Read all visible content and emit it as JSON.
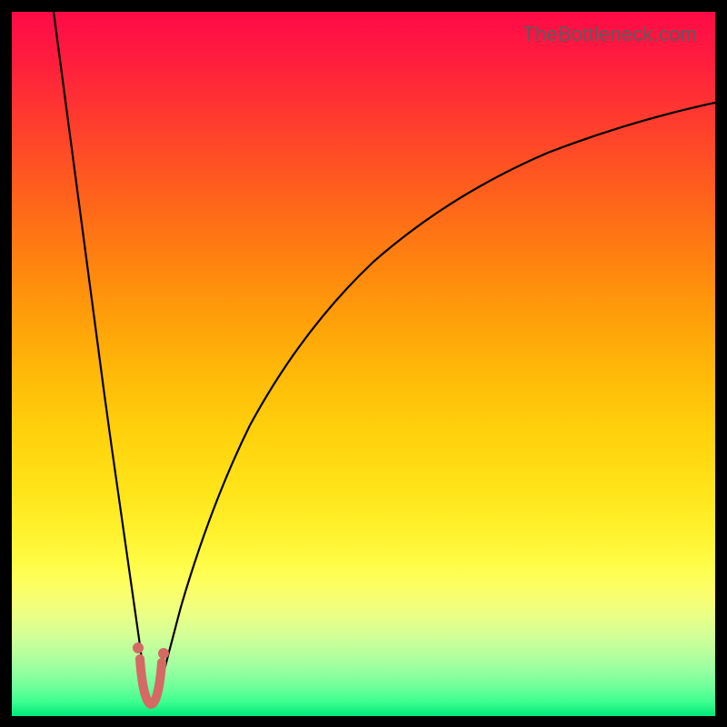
{
  "watermark": "TheBottleneck.com",
  "colors": {
    "frame": "#000000",
    "curve": "#000000",
    "marker": "#d46a63",
    "gradient_top": "#ff0b47",
    "gradient_bottom": "#00e77a"
  },
  "chart_data": {
    "type": "line",
    "title": "",
    "xlabel": "",
    "ylabel": "",
    "xlim": [
      0,
      100
    ],
    "ylim": [
      0,
      100
    ],
    "note": "Bottleneck-style curve: y is percent mismatch vs x (component ratio). Minimum near x≈19 where curve touches green band. No numeric axis labels shown in image; values estimated from curve geometry.",
    "series": [
      {
        "name": "bottleneck-curve",
        "x": [
          6,
          8,
          10,
          12,
          14,
          16,
          17,
          18,
          19,
          20,
          21,
          22,
          24,
          27,
          31,
          36,
          42,
          50,
          60,
          72,
          86,
          100
        ],
        "values": [
          100,
          87,
          73,
          58,
          42,
          24,
          14,
          6,
          1,
          3,
          8,
          15,
          27,
          40,
          52,
          62,
          70,
          77,
          82,
          86,
          89,
          91
        ]
      }
    ],
    "markers": {
      "name": "optimal-region",
      "x": [
        17.5,
        18.5,
        19.5,
        20.5
      ],
      "values": [
        9,
        2,
        1,
        4
      ]
    }
  }
}
